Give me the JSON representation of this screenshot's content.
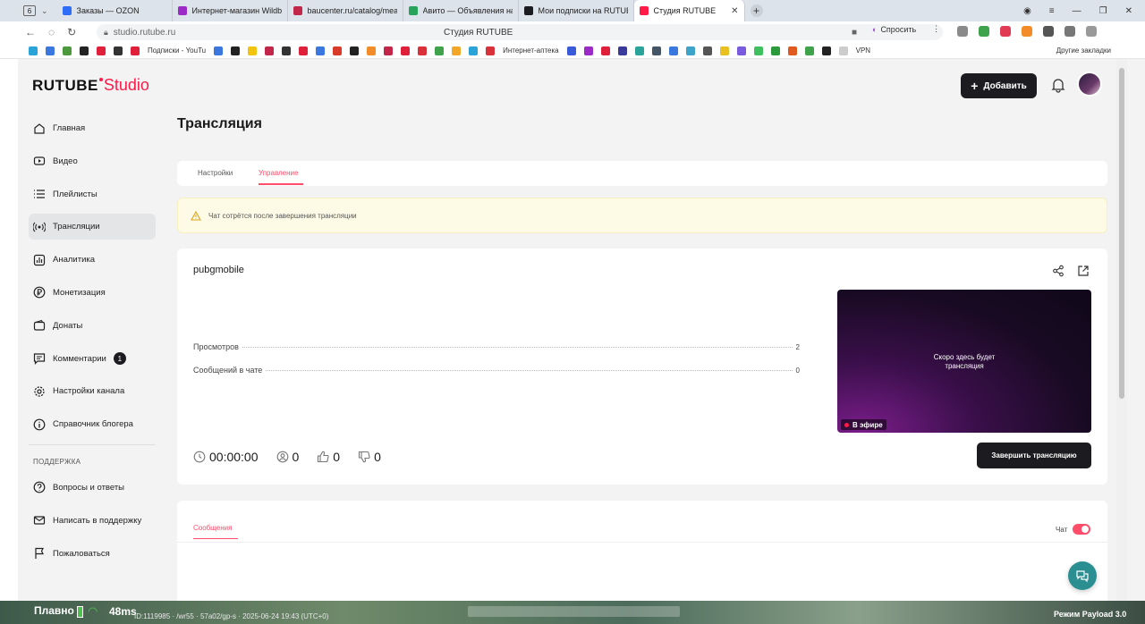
{
  "browser": {
    "tab_count": "6",
    "tabs": [
      {
        "label": "Заказы — OZON",
        "color": "#2f6df6"
      },
      {
        "label": "Интернет-магазин Wildb",
        "color": "#9b2ac6"
      },
      {
        "label": "baucenter.ru/catalog/mea",
        "color": "#c2274a"
      },
      {
        "label": "Авито — Объявления на с",
        "color": "#27a35a"
      },
      {
        "label": "Мои подписки на RUTUBE",
        "color": "#1c1c20"
      },
      {
        "label": "Студия RUTUBE",
        "color": "#ff1a47",
        "active": true
      }
    ],
    "url": "studio.rutube.ru",
    "page_title": "Студия RUTUBE",
    "ask_label": "Спросить",
    "bookmarks": [
      "Подписки - YouTu",
      "Интернет-аптека",
      "VPN"
    ],
    "other_bookmarks": "Другие закладки"
  },
  "header": {
    "logo_brand": "RUTUBE",
    "logo_product": "Studio",
    "add_button": "Добавить"
  },
  "sidebar": {
    "items": [
      {
        "label": "Главная",
        "icon": "home-icon"
      },
      {
        "label": "Видео",
        "icon": "video-icon"
      },
      {
        "label": "Плейлисты",
        "icon": "playlist-icon"
      },
      {
        "label": "Трансляции",
        "icon": "broadcast-icon",
        "active": true
      },
      {
        "label": "Аналитика",
        "icon": "analytics-icon"
      },
      {
        "label": "Монетизация",
        "icon": "ruble-icon"
      },
      {
        "label": "Донаты",
        "icon": "wallet-icon"
      },
      {
        "label": "Комментарии",
        "icon": "comment-icon",
        "badge": "1"
      },
      {
        "label": "Настройки канала",
        "icon": "gear-icon"
      },
      {
        "label": "Справочник блогера",
        "icon": "info-icon"
      }
    ],
    "support_heading": "ПОДДЕРЖКА",
    "support_items": [
      {
        "label": "Вопросы и ответы",
        "icon": "question-icon"
      },
      {
        "label": "Написать в поддержку",
        "icon": "mail-icon"
      },
      {
        "label": "Пожаловаться",
        "icon": "flag-icon"
      }
    ]
  },
  "main": {
    "title": "Трансляция",
    "tabs": [
      "Настройки",
      "Управление"
    ],
    "active_tab": "Управление",
    "warning": "Чат сотрётся после завершения трансляции",
    "stream": {
      "name": "pubgmobile",
      "stats": [
        {
          "label": "Просмотров",
          "value": "2"
        },
        {
          "label": "Сообщений в чате",
          "value": "0"
        }
      ],
      "preview_text": "Скоро здесь будет трансляция",
      "live_label": "В эфире",
      "timer": "00:00:00",
      "viewers": "0",
      "likes": "0",
      "dislikes": "0",
      "end_button": "Завершить трансляцию"
    },
    "messages_tab": "Сообщения",
    "chat_label": "Чат",
    "chat_enabled": true
  },
  "overlay": {
    "smooth_label": "Плавно",
    "ping": "48ms",
    "info": "ID:1119985 · /wr55 · 57a02/gp-s · 2025-06-24 19:43 (UTC+0)",
    "mode": "Режим Payload 3.0"
  }
}
